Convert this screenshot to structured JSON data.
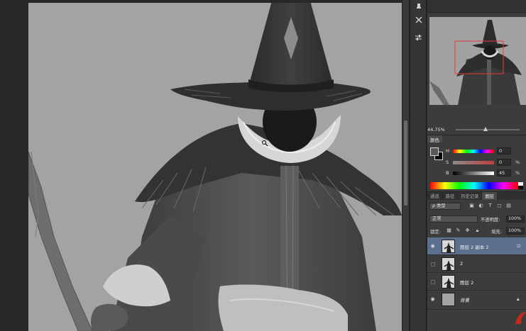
{
  "navigator": {
    "zoom": "44.75%"
  },
  "color_panel": {
    "tab_label": "颜色",
    "h_label": "H",
    "h_value": "0",
    "s_label": "S",
    "s_value": "0",
    "s_unit": "%",
    "b_label": "B",
    "b_value": "45",
    "b_unit": "%",
    "foreground_color": "#585858",
    "background_color": "#000000"
  },
  "layers_panel": {
    "tabs": [
      {
        "label": "通道",
        "active": false
      },
      {
        "label": "路径",
        "active": false
      },
      {
        "label": "历史记录",
        "active": false
      },
      {
        "label": "图层",
        "active": true
      }
    ],
    "filter_kind": "ρ 类型",
    "blend_mode": "正常",
    "opacity_label": "不透明度:",
    "opacity_value": "100%",
    "lock_label": "锁定:",
    "fill_label": "填充:",
    "fill_value": "100%",
    "layers": [
      {
        "name": "图层 2 副本 2",
        "visible": true,
        "selected": true,
        "italic": false,
        "locked": false
      },
      {
        "name": "2",
        "visible": false,
        "selected": false,
        "italic": false,
        "locked": false
      },
      {
        "name": "图层 2",
        "visible": false,
        "selected": false,
        "italic": false,
        "locked": false
      },
      {
        "name": "背景",
        "visible": true,
        "selected": false,
        "italic": true,
        "locked": true
      }
    ]
  },
  "colors": {
    "selected_layer": "#5c6f8d",
    "panel_bg": "#3c3c3c",
    "canvas_bg": "#a3a3a3",
    "navigator_frame": "#e03a3a",
    "logo": "#c8281e"
  },
  "icons": {
    "tool_strip": [
      "history-brush-icon",
      "tools-cross-icon",
      "adjust-sliders-icon"
    ],
    "filter_icons": [
      "image-filter-icon",
      "adjustment-filter-icon",
      "type-filter-icon",
      "shape-filter-icon",
      "smart-filter-icon"
    ],
    "lock_icons": [
      "lock-transparent-icon",
      "lock-paint-icon",
      "lock-move-icon",
      "lock-all-icon"
    ]
  }
}
